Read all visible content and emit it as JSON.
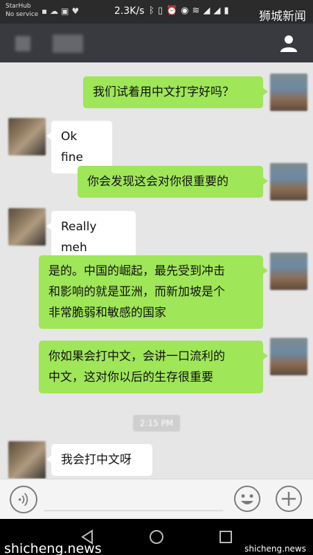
{
  "status_bar": {
    "carrier_line1": "StarHub",
    "carrier_line2": "No service",
    "network_speed": "2.3K/s",
    "icons": [
      "sim-icon",
      "cloud-icon",
      "image-icon",
      "heart-icon",
      "bluetooth-icon",
      "vibrate-icon",
      "alarm-icon",
      "eye-icon",
      "wifi-icon",
      "signal-icon",
      "signal-icon",
      "battery-icon"
    ]
  },
  "watermark": {
    "top_right": "狮城新闻",
    "bottom_left": "shicheng.news",
    "bottom_right": "shicheng.news"
  },
  "chat": {
    "messages": [
      {
        "sender": "me",
        "text": "我们试着用中文打字好吗？"
      },
      {
        "sender": "them",
        "text": "Ok fine"
      },
      {
        "sender": "me",
        "text": "你会发现这会对你很重要的"
      },
      {
        "sender": "them",
        "text": "Really meh"
      },
      {
        "sender": "me",
        "lines": [
          "是的。中国的崛起，最先受到冲击",
          "和影响的就是亚洲，而新加坡是个",
          "非常脆弱和敏感的国家"
        ]
      },
      {
        "sender": "me",
        "lines": [
          "你如果会打中文，会讲一口流利的",
          "中文，这对你以后的生存很重要"
        ]
      },
      {
        "sender": "them",
        "text": "我会打中文呀"
      }
    ],
    "timestamp": "2:15 PM"
  },
  "colors": {
    "header_bg": "#393a3f",
    "chat_bg": "#e6e6e6",
    "my_bubble": "#9fe658",
    "their_bubble": "#ffffff"
  }
}
